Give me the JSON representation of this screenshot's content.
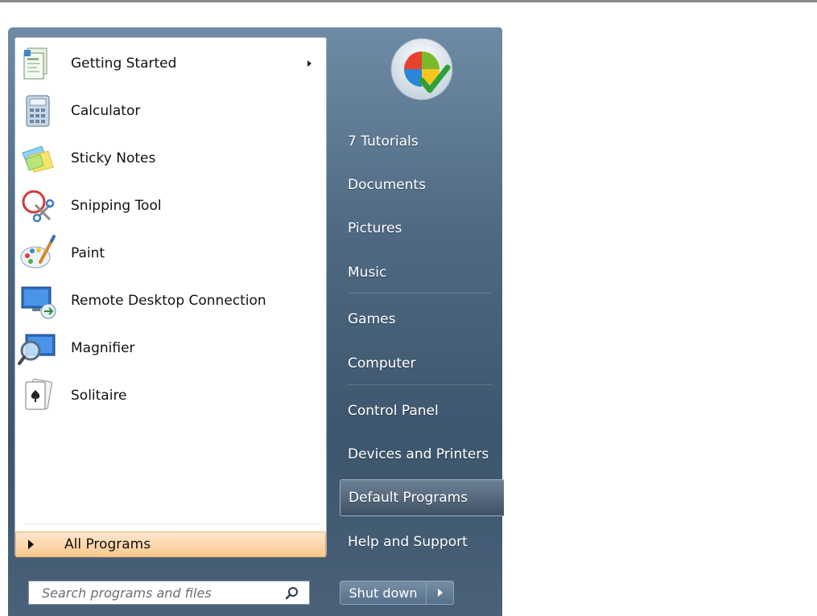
{
  "programs": [
    {
      "label": "Getting Started",
      "icon": "getting-started-icon",
      "has_submenu": true
    },
    {
      "label": "Calculator",
      "icon": "calculator-icon"
    },
    {
      "label": "Sticky Notes",
      "icon": "sticky-notes-icon"
    },
    {
      "label": "Snipping Tool",
      "icon": "snipping-tool-icon"
    },
    {
      "label": "Paint",
      "icon": "paint-icon"
    },
    {
      "label": "Remote Desktop Connection",
      "icon": "remote-desktop-icon"
    },
    {
      "label": "Magnifier",
      "icon": "magnifier-icon"
    },
    {
      "label": "Solitaire",
      "icon": "solitaire-icon"
    }
  ],
  "all_programs": {
    "label": "All Programs"
  },
  "search": {
    "placeholder": "Search programs and files"
  },
  "right_items": [
    {
      "label": "7 Tutorials"
    },
    {
      "label": "Documents"
    },
    {
      "label": "Pictures"
    },
    {
      "label": "Music"
    },
    {
      "label": "Games"
    },
    {
      "label": "Computer"
    },
    {
      "label": "Control Panel"
    },
    {
      "label": "Devices and Printers"
    },
    {
      "label": "Default Programs",
      "highlighted": true
    },
    {
      "label": "Help and Support"
    }
  ],
  "shutdown": {
    "label": "Shut down"
  },
  "colors": {
    "menu_bg_top": "#6e8ba6",
    "menu_bg_bottom": "#3d566d",
    "all_programs_highlight": "#fbc98c"
  }
}
